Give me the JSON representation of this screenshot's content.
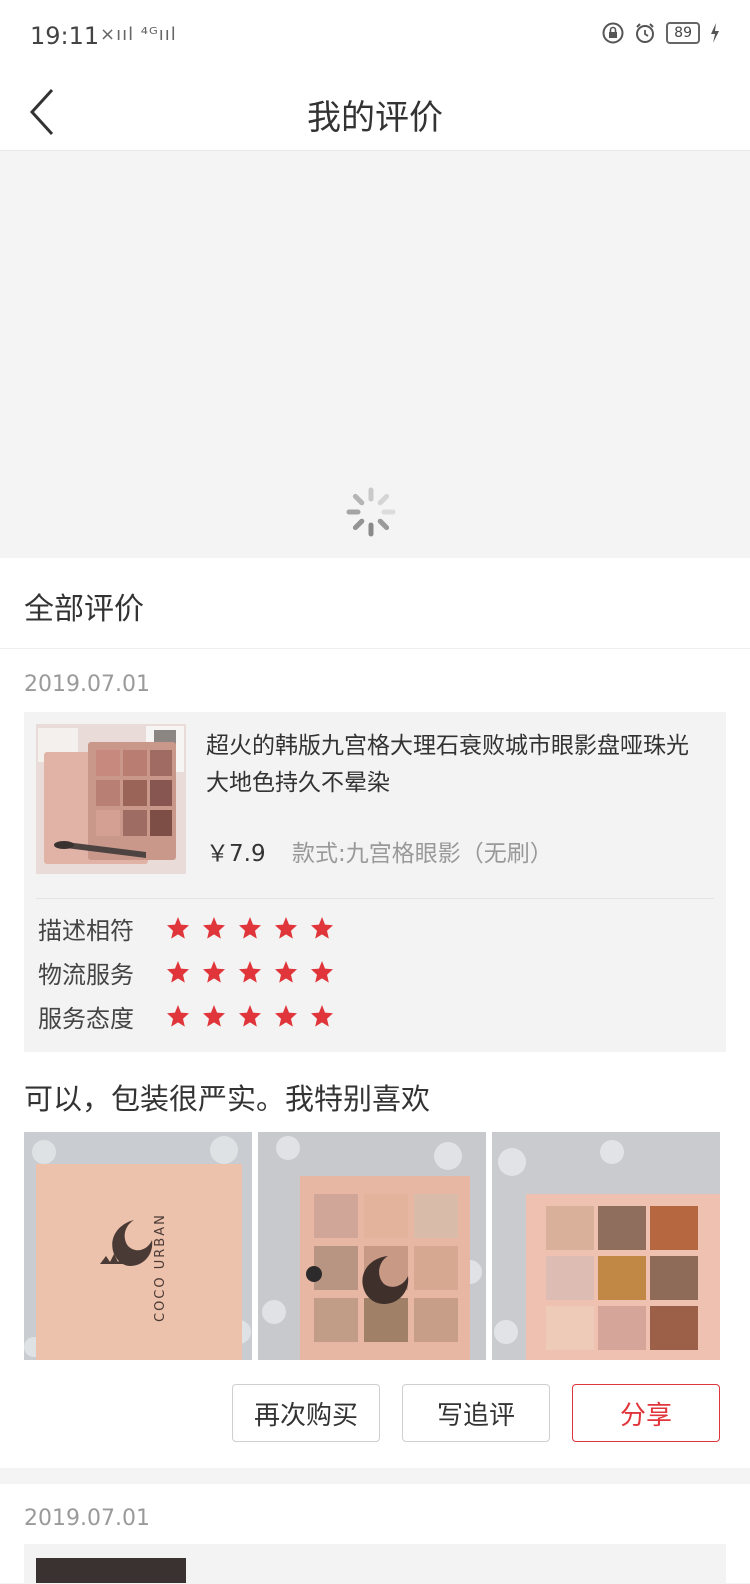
{
  "status_bar": {
    "time": "19:11",
    "signal": "×ııl ⁴ᴳııl",
    "battery": "89"
  },
  "nav": {
    "title": "我的评价"
  },
  "section": {
    "title": "全部评价"
  },
  "review": {
    "date": "2019.07.01",
    "product_name": "超火的韩版九宫格大理石衰败城市眼影盘哑珠光大地色持久不晕染",
    "price": "￥7.9",
    "variant": "款式:九宫格眼影（无刷）",
    "ratings": [
      {
        "label": "描述相符",
        "stars": 5
      },
      {
        "label": "物流服务",
        "stars": 5
      },
      {
        "label": "服务态度",
        "stars": 5
      }
    ],
    "comment": "可以，包装很严实。我特别喜欢",
    "photo_brand_text": "COCO URBAN",
    "actions": {
      "rebuy": "再次购买",
      "follow_up": "写追评",
      "share": "分享"
    }
  },
  "review2": {
    "date": "2019.07.01"
  },
  "colors": {
    "accent": "#e0353a",
    "star": "#e0353a",
    "background": "#f4f4f4"
  }
}
